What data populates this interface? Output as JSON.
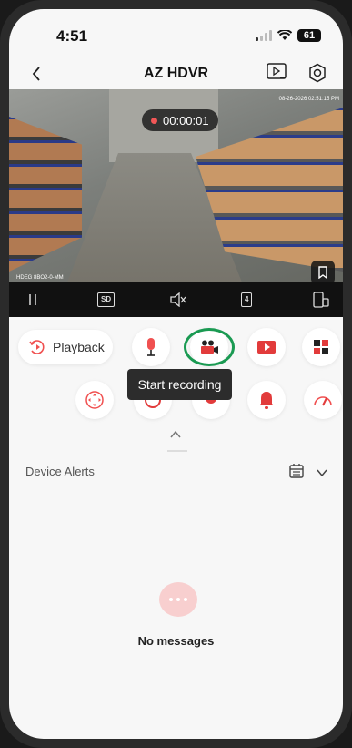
{
  "status_bar": {
    "time": "4:51",
    "battery": "61"
  },
  "nav": {
    "title": "AZ HDVR"
  },
  "camera": {
    "recording_timer": "00:00:01",
    "timestamp": "08-26-2026 02:51:15 PM",
    "channel_label": "HDEG 8BO2-0-MM"
  },
  "controls": {
    "quality": "SD",
    "split_count": "4"
  },
  "features": {
    "playback_label": "Playback",
    "tooltip": "Start recording"
  },
  "alerts": {
    "title": "Device Alerts",
    "empty_text": "No messages"
  },
  "colors": {
    "accent_red": "#f05050",
    "highlight_green": "#1a9a52"
  }
}
